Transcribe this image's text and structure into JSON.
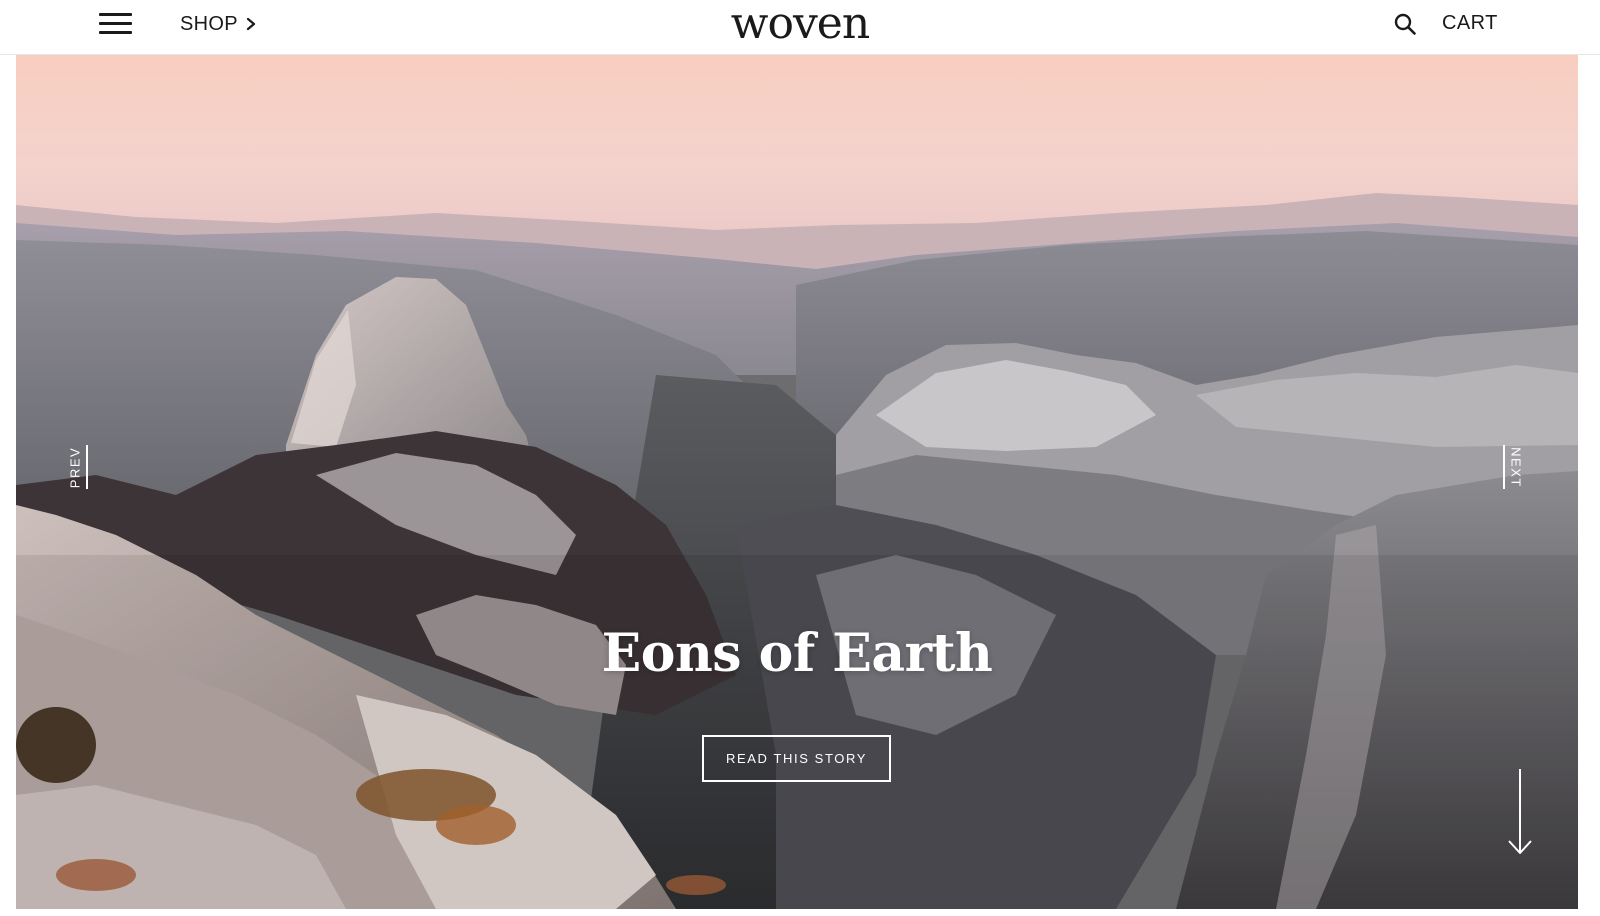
{
  "header": {
    "menu_icon": "hamburger-menu-icon",
    "shop_label": "SHOP",
    "shop_icon": "chevron-right-icon",
    "logo": "woven",
    "search_icon": "search-icon",
    "cart_label": "CART"
  },
  "hero": {
    "title": "Eons of Earth",
    "cta_label": "READ THIS STORY",
    "prev_label": "PREV",
    "next_label": "NEXT",
    "scroll_icon": "arrow-down-icon",
    "background": "mountain-valley-landscape-photo"
  },
  "colors": {
    "text": "#1a1a1a",
    "sky_top": "#f8cfc0",
    "overlay_text": "#ffffff"
  }
}
